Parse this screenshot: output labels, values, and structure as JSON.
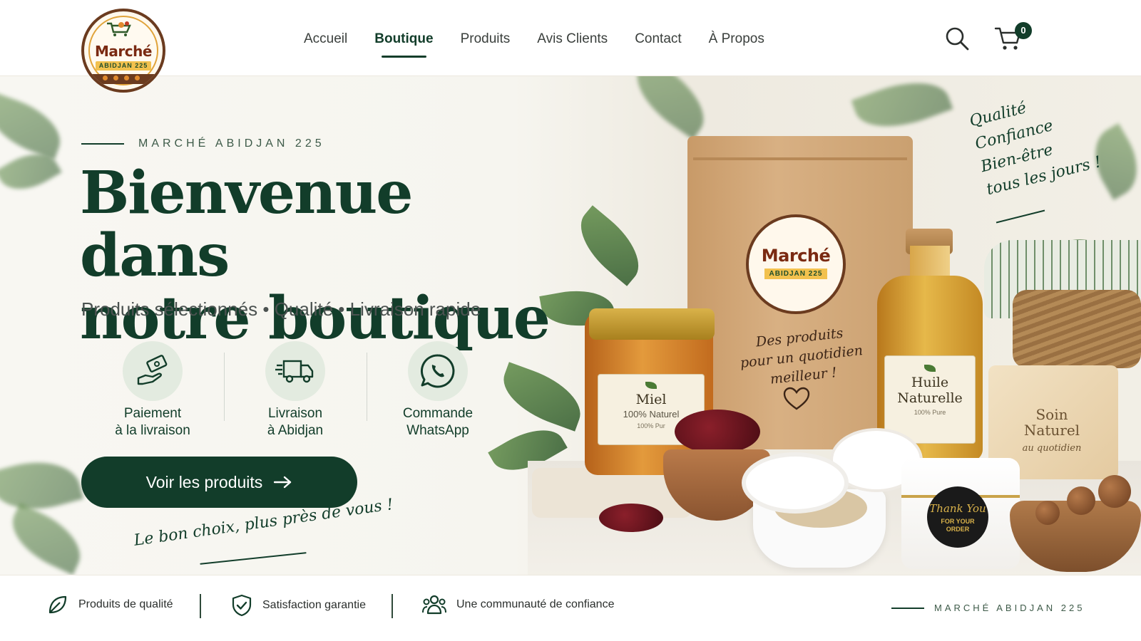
{
  "brand": {
    "logo_word": "Marché",
    "logo_sub": "ABIDJAN 225"
  },
  "nav": {
    "items": [
      {
        "label": "Accueil",
        "active": false
      },
      {
        "label": "Boutique",
        "active": true
      },
      {
        "label": "Produits",
        "active": false
      },
      {
        "label": "Avis Clients",
        "active": false
      },
      {
        "label": "Contact",
        "active": false
      },
      {
        "label": "À Propos",
        "active": false
      }
    ],
    "cart_count": "0"
  },
  "hero": {
    "eyebrow": "MARCHÉ ABIDJAN 225",
    "title_line1": "Bienvenue dans",
    "title_line2": "notre boutique",
    "subtitle": "Produits sélectionnés • Qualité • Livraison rapide",
    "features": [
      {
        "line1": "Paiement",
        "line2": "à la livraison",
        "icon": "cash-hand-icon"
      },
      {
        "line1": "Livraison",
        "line2": "à Abidjan",
        "icon": "delivery-truck-icon"
      },
      {
        "line1": "Commande",
        "line2": "WhatsApp",
        "icon": "whatsapp-icon"
      }
    ],
    "cta_label": "Voir les produits",
    "tagline_bottom": "Le bon choix, plus près de vous !",
    "tagline_top": [
      "Qualité",
      "Confiance",
      "Bien-être",
      "tous les jours !"
    ]
  },
  "products": {
    "pouch_text": [
      "Des produits",
      "pour un quotidien",
      "meilleur !"
    ],
    "honey": {
      "name": "Miel",
      "sub": "100% Naturel",
      "tiny": "100% Pur"
    },
    "oil": {
      "name_line1": "Huile",
      "name_line2": "Naturelle",
      "tiny": "100% Pure"
    },
    "soap": {
      "line1": "Soin",
      "line2": "Naturel",
      "script": "au quotidien"
    },
    "thank_you": {
      "script": "Thank You",
      "line1": "FOR YOUR",
      "line2": "ORDER"
    }
  },
  "footer": {
    "items": [
      {
        "label": "Produits de qualité",
        "icon": "leaf-icon"
      },
      {
        "label": "Satisfaction garantie",
        "icon": "shield-check-icon"
      },
      {
        "label": "Une communauté de confiance",
        "icon": "community-icon"
      }
    ],
    "brand": "MARCHÉ ABIDJAN 225"
  },
  "colors": {
    "primary": "#123d2a",
    "accent_gold": "#f2c14e",
    "brown": "#6b3b1f",
    "background": "#f8f7f2"
  }
}
